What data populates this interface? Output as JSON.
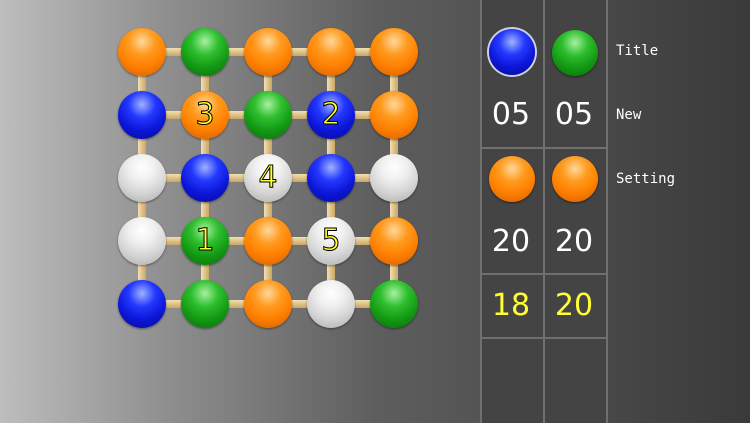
{
  "board": {
    "colors": {
      "orange": "#ff8000",
      "green": "#139a13",
      "blue": "#0c16d8",
      "white": "#d4d4d4",
      "rod": "#e0c58a",
      "number": "#ffff33"
    },
    "rows": [
      [
        {
          "color": "orange",
          "label": ""
        },
        {
          "color": "green",
          "label": ""
        },
        {
          "color": "orange",
          "label": ""
        },
        {
          "color": "orange",
          "label": ""
        },
        {
          "color": "orange",
          "label": ""
        }
      ],
      [
        {
          "color": "blue",
          "label": ""
        },
        {
          "color": "orange",
          "label": "3"
        },
        {
          "color": "green",
          "label": ""
        },
        {
          "color": "blue",
          "label": "2"
        },
        {
          "color": "orange",
          "label": ""
        }
      ],
      [
        {
          "color": "white",
          "label": ""
        },
        {
          "color": "blue",
          "label": ""
        },
        {
          "color": "white",
          "label": "4"
        },
        {
          "color": "blue",
          "label": ""
        },
        {
          "color": "white",
          "label": ""
        }
      ],
      [
        {
          "color": "white",
          "label": ""
        },
        {
          "color": "green",
          "label": "1"
        },
        {
          "color": "orange",
          "label": ""
        },
        {
          "color": "white",
          "label": "5"
        },
        {
          "color": "orange",
          "label": ""
        }
      ],
      [
        {
          "color": "blue",
          "label": ""
        },
        {
          "color": "green",
          "label": ""
        },
        {
          "color": "orange",
          "label": ""
        },
        {
          "color": "white",
          "label": ""
        },
        {
          "color": "green",
          "label": ""
        }
      ]
    ]
  },
  "panel": {
    "row1": {
      "left_ball": "blue",
      "right_ball": "green",
      "left_score": "05",
      "right_score": "05"
    },
    "row2": {
      "left_ball": "orange",
      "right_ball": "orange",
      "left_score": "20",
      "right_score": "20"
    },
    "row3": {
      "left_score": "18",
      "right_score": "20"
    }
  },
  "menu": {
    "title": "Title",
    "new": "New",
    "setting": "Setting"
  }
}
